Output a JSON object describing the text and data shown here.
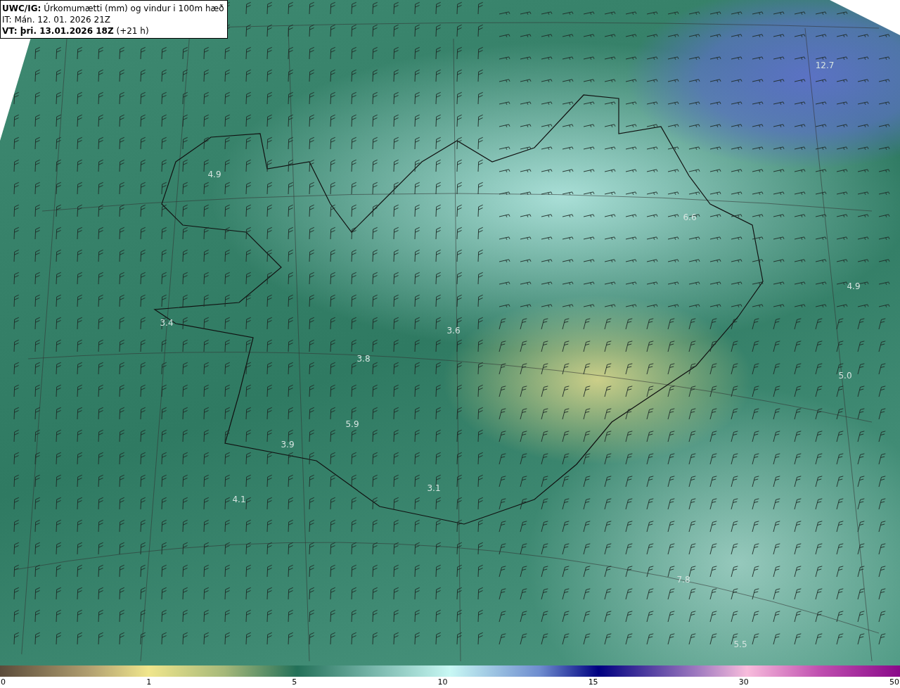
{
  "header": {
    "title_bold": "UWC/IG:",
    "title": "Úrkomumætti (mm) og vindur i 100m hæð",
    "init": "IT: Mán. 12. 01. 2026 21Z",
    "valid_bold": "VT: þri. 13.01.2026 18Z",
    "valid_suffix": "(+21 h)"
  },
  "map_values": [
    "4.9",
    "3.4",
    "3.8",
    "3.6",
    "5.9",
    "3.9",
    "4.1",
    "3.1",
    "6.6",
    "12.7",
    "4.9",
    "5.0",
    "7.8",
    "5.5"
  ],
  "colorbar": {
    "ticks": [
      "0",
      "1",
      "5",
      "10",
      "15",
      "30",
      "50"
    ]
  }
}
